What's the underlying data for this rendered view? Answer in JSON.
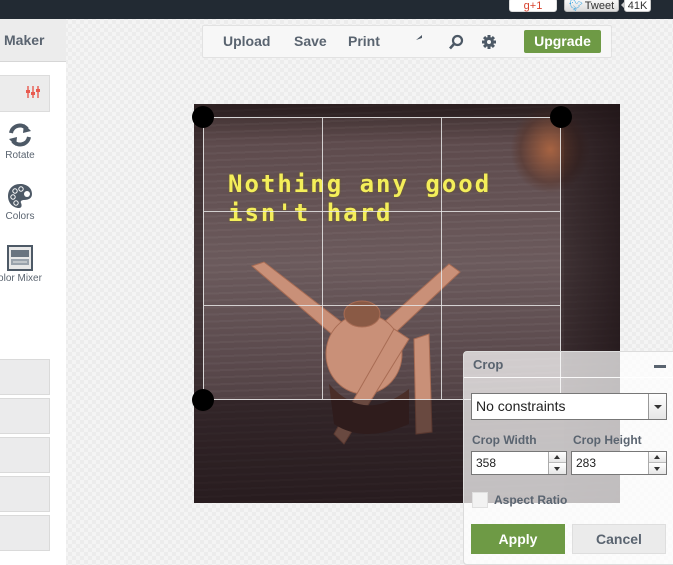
{
  "topbar": {
    "gplus_label": "g+1",
    "tweet_label": "Tweet",
    "tweet_count": "41K"
  },
  "sidebar": {
    "title": "Maker",
    "tools": [
      {
        "label": "Rotate",
        "icon": "rotate-icon"
      },
      {
        "label": "Colors",
        "icon": "palette-icon"
      },
      {
        "label": "olor Mixer",
        "icon": "color-mixer-icon"
      }
    ]
  },
  "toolbar": {
    "upload_label": "Upload",
    "save_label": "Save",
    "print_label": "Print",
    "upgrade_label": "Upgrade",
    "icons": [
      "undo-icon",
      "search-icon",
      "gear-icon"
    ]
  },
  "canvas": {
    "quote_line1": "Nothing any good",
    "quote_line2": "isn't hard",
    "quote_color": "#f4ee5a"
  },
  "crop_panel": {
    "title": "Crop",
    "constraint_selected": "No constraints",
    "width_label": "Crop Width",
    "height_label": "Crop Height",
    "width_value": "358",
    "height_value": "283",
    "aspect_ratio_label": "Aspect Ratio",
    "aspect_ratio_checked": false,
    "apply_label": "Apply",
    "cancel_label": "Cancel"
  },
  "colors": {
    "accent_green": "#6e9a45",
    "topbar": "#222a33",
    "text": "#5a6470"
  }
}
